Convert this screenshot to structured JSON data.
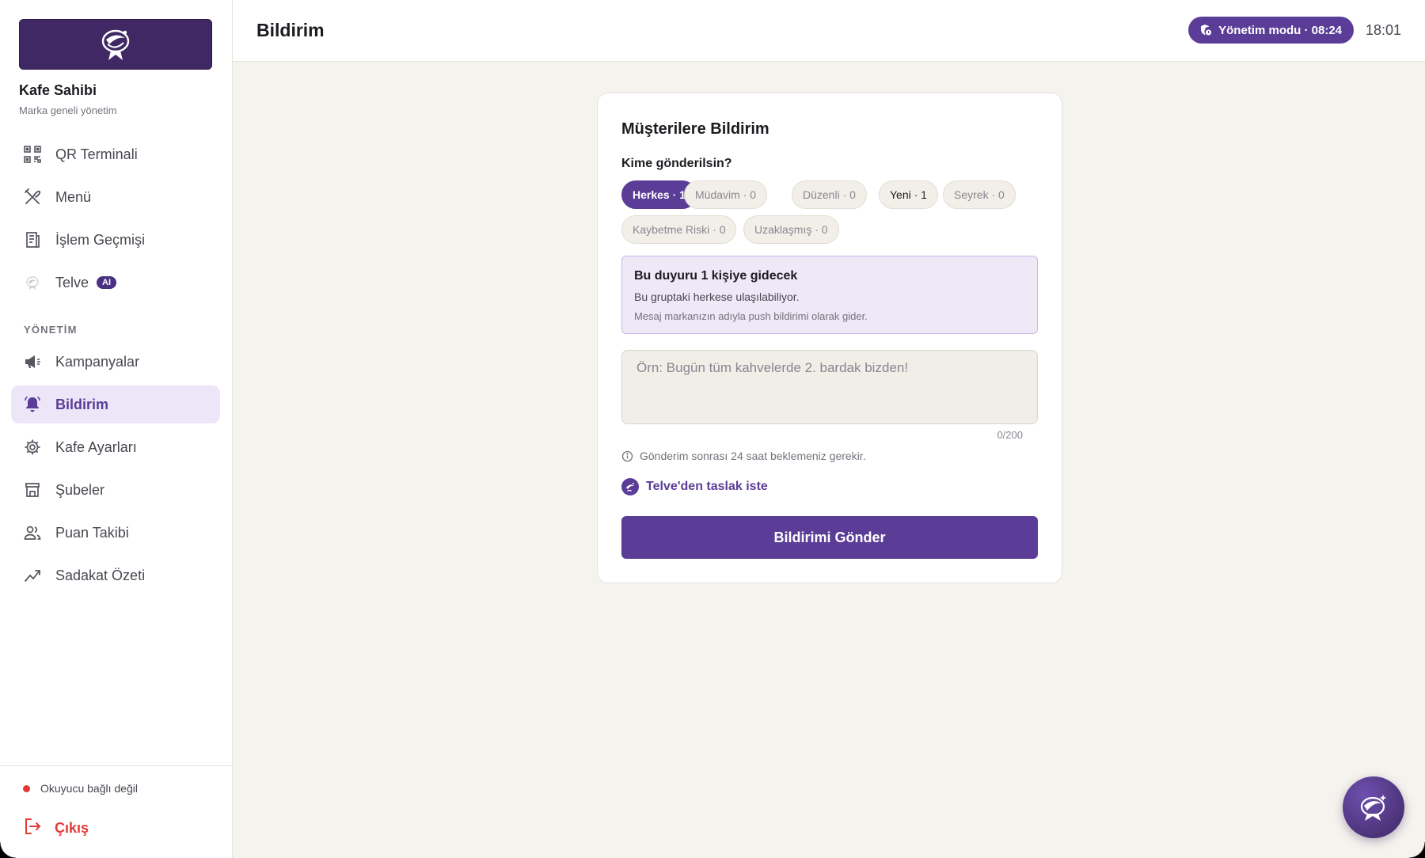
{
  "sidebar": {
    "owner_name": "Kafe Sahibi",
    "owner_subtitle": "Marka geneli yönetim",
    "items": [
      {
        "label": "QR Terminali",
        "icon": "qr-code-icon"
      },
      {
        "label": "Menü",
        "icon": "utensils-icon"
      },
      {
        "label": "İşlem Geçmişi",
        "icon": "receipt-icon"
      },
      {
        "label": "Telve",
        "icon": "telve-icon",
        "badge": "AI"
      }
    ],
    "section_label": "YÖNETİM",
    "admin_items": [
      {
        "label": "Kampanyalar",
        "icon": "megaphone-icon"
      },
      {
        "label": "Bildirim",
        "icon": "bell-icon",
        "active": true
      },
      {
        "label": "Kafe Ayarları",
        "icon": "gear-icon"
      },
      {
        "label": "Şubeler",
        "icon": "store-icon"
      },
      {
        "label": "Puan Takibi",
        "icon": "users-icon"
      },
      {
        "label": "Sadakat Özeti",
        "icon": "trend-icon"
      }
    ],
    "reader_status": "Okuyucu bağlı değil",
    "logout_label": "Çıkış"
  },
  "header": {
    "title": "Bildirim",
    "mode_pill": "Yönetim modu · 08:24",
    "clock": "18:01"
  },
  "card": {
    "title": "Müşterilere Bildirim",
    "target_label": "Kime gönderilsin?",
    "segments": [
      {
        "label": "Herkes · 1",
        "selected": true
      },
      {
        "label": "Müdavim · 0"
      },
      {
        "label": "Düzenli · 0"
      },
      {
        "label": "Yeni · 1"
      },
      {
        "label": "Seyrek · 0"
      },
      {
        "label": "Kaybetme Riski · 0"
      },
      {
        "label": "Uzaklaşmış · 0"
      }
    ],
    "info": {
      "title": "Bu duyuru 1 kişiye gidecek",
      "line1": "Bu gruptaki herkese ulaşılabiliyor.",
      "line2": "Mesaj markanızın adıyla push bildirimi olarak gider."
    },
    "message": {
      "value": "",
      "placeholder": "Örn: Bugün tüm kahvelerde 2. bardak bizden!",
      "counter": "0/200"
    },
    "wait_note": "Gönderim sonrası 24 saat beklemeniz gerekir.",
    "draft_link": "Telve'den taslak iste",
    "send_button": "Bildirimi Gönder"
  },
  "colors": {
    "accent": "#5b3d98",
    "brand_dark": "#3f2863",
    "danger": "#e53935",
    "background": "#f5f3ee"
  }
}
